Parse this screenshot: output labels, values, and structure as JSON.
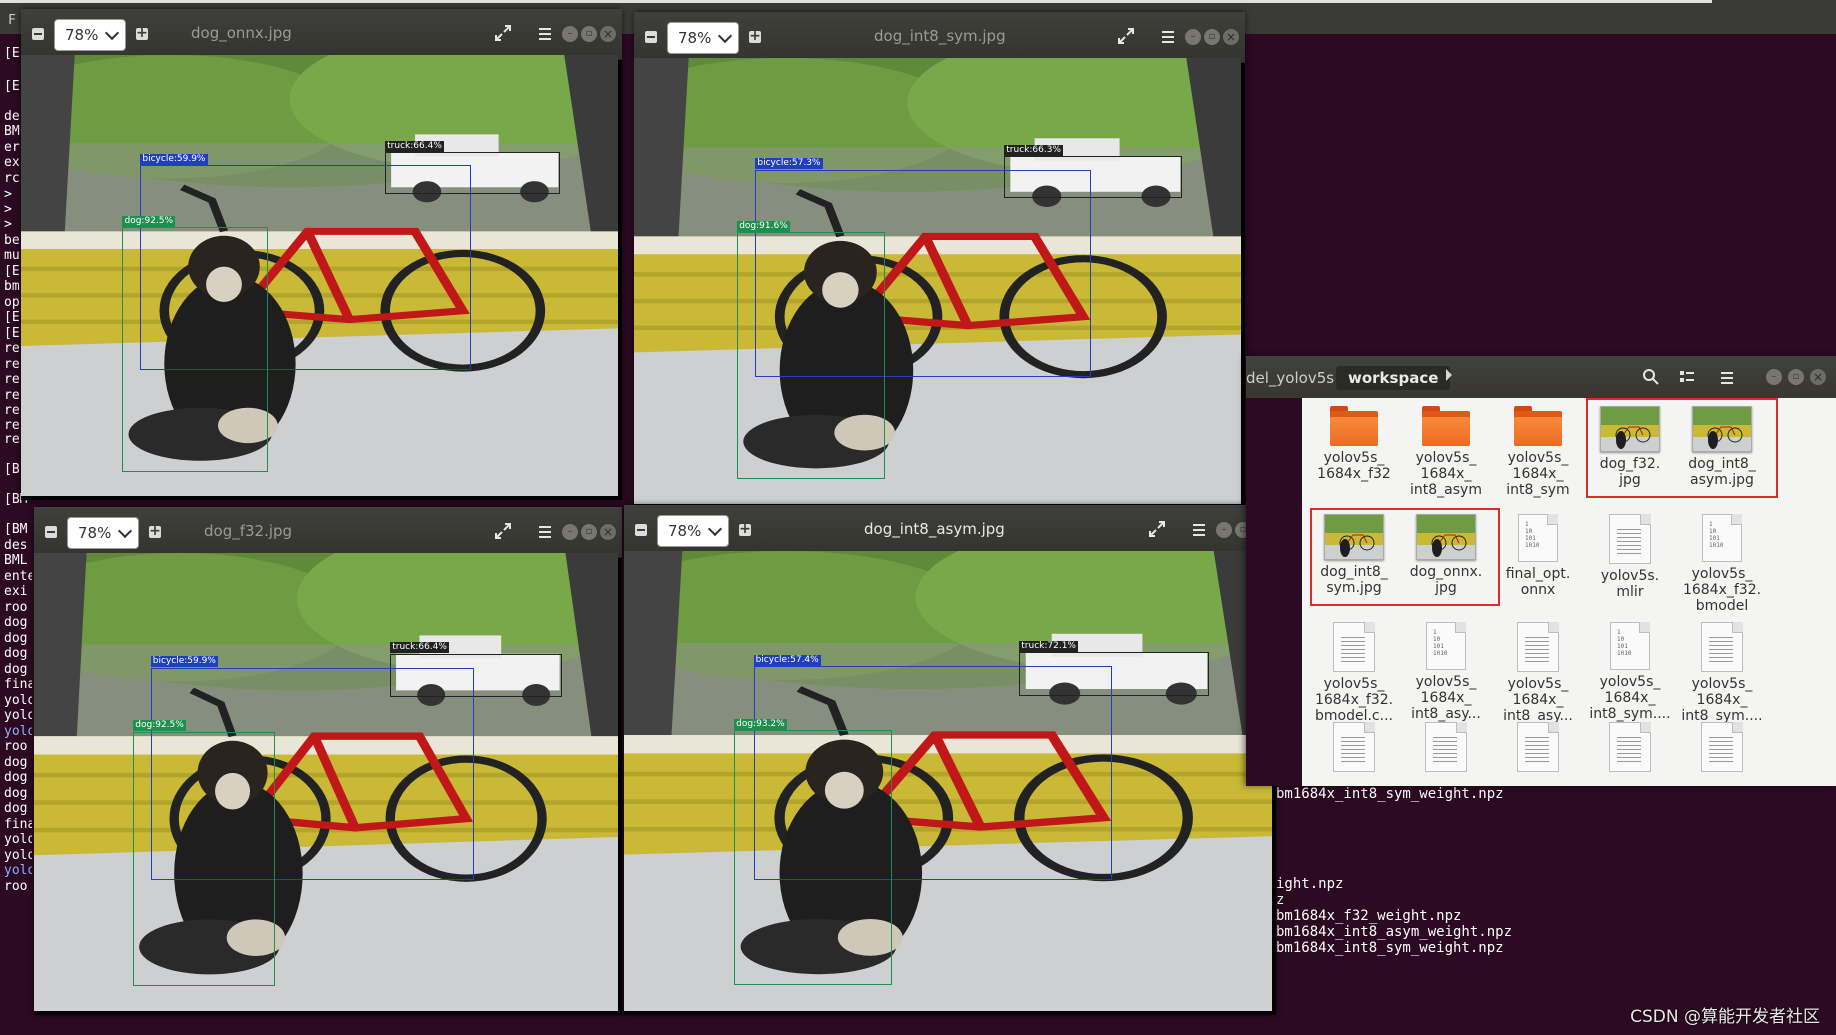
{
  "terminal": {
    "top_menu": "F",
    "left_fragments": [
      "[E",
      "[E",
      "de",
      "BM",
      "er",
      "ex",
      "rc",
      ">",
      ">",
      ">",
      "be",
      "mu",
      "[E",
      "bm",
      "op",
      "[E",
      "[E",
      "re",
      "re",
      "re",
      "re",
      "re",
      "re",
      "re",
      "[B",
      "[BM",
      "[BM",
      "des",
      "BML",
      "ente",
      "exi",
      "roo",
      "dog",
      "dog",
      "dog",
      "dog",
      "fina",
      "yolo",
      "yolo",
      "yolo",
      "roo",
      "dog",
      "dog",
      "dog",
      "dog",
      "fina",
      "yolo",
      "yolo",
      "yolo",
      "roo"
    ],
    "right_lines": [
      "bm1684x_int8_asym_weight.npz",
      "bm1684x_int8_sym_weight.npz",
      "ight.npz",
      "z",
      "bm1684x_f32_weight.npz",
      "bm1684x_int8_asym_weight.npz",
      "bm1684x_int8_sym_weight.npz"
    ]
  },
  "viewers": [
    {
      "name": "dog_onnx",
      "title": "dog_onnx.jpg",
      "zoom": "78%",
      "active": false,
      "detections": [
        {
          "label": "truck:66.4%",
          "color": "#222222"
        },
        {
          "label": "bicycle:59.9%",
          "color": "#1f3fbf"
        },
        {
          "label": "dog:92.5%",
          "color": "#1f8f4f"
        }
      ]
    },
    {
      "name": "dog_int8_sym",
      "title": "dog_int8_sym.jpg",
      "zoom": "78%",
      "active": false,
      "detections": [
        {
          "label": "truck:66.3%",
          "color": "#222222"
        },
        {
          "label": "bicycle:57.3%",
          "color": "#1f3fbf"
        },
        {
          "label": "dog:91.6%",
          "color": "#1f8f4f"
        }
      ]
    },
    {
      "name": "dog_f32",
      "title": "dog_f32.jpg",
      "zoom": "78%",
      "active": false,
      "detections": [
        {
          "label": "truck:66.4%",
          "color": "#222222"
        },
        {
          "label": "bicycle:59.9%",
          "color": "#1f3fbf"
        },
        {
          "label": "dog:92.5%",
          "color": "#1f8f4f"
        }
      ]
    },
    {
      "name": "dog_int8_asym",
      "title": "dog_int8_asym.jpg",
      "zoom": "78%",
      "active": true,
      "detections": [
        {
          "label": "truck:72.1%",
          "color": "#222222"
        },
        {
          "label": "bicycle:57.4%",
          "color": "#1f3fbf"
        },
        {
          "label": "dog:93.2%",
          "color": "#1f8f4f"
        }
      ]
    }
  ],
  "file_manager": {
    "breadcrumb_prev": "del_yolov5s",
    "breadcrumb_current": "workspace",
    "icons": [
      "search-icon",
      "view-list-icon",
      "menu-icon",
      "minimize-icon",
      "maximize-icon",
      "close-icon"
    ],
    "items": [
      {
        "label": "yolov5s_\n1684x_f32",
        "kind": "folder"
      },
      {
        "label": "yolov5s_\n1684x_\nint8_asym",
        "kind": "folder"
      },
      {
        "label": "yolov5s_\n1684x_\nint8_sym",
        "kind": "folder"
      },
      {
        "label": "dog_f32.\njpg",
        "kind": "image"
      },
      {
        "label": "dog_int8_\nasym.jpg",
        "kind": "image"
      },
      {
        "label": "dog_int8_\nsym.jpg",
        "kind": "image"
      },
      {
        "label": "dog_onnx.\njpg",
        "kind": "image"
      },
      {
        "label": "final_opt.\nonnx",
        "kind": "binary"
      },
      {
        "label": "yolov5s.\nmlir",
        "kind": "text"
      },
      {
        "label": "yolov5s_\n1684x_f32.\nbmodel",
        "kind": "binary"
      },
      {
        "label": "yolov5s_\n1684x_f32.\nbmodel.c...",
        "kind": "text"
      },
      {
        "label": "yolov5s_\n1684x_\nint8_asy...",
        "kind": "binary"
      },
      {
        "label": "yolov5s_\n1684x_\nint8_asy...",
        "kind": "text"
      },
      {
        "label": "yolov5s_\n1684x_\nint8_sym....",
        "kind": "binary"
      },
      {
        "label": "yolov5s_\n1684x_\nint8_sym....",
        "kind": "text"
      },
      {
        "label": "",
        "kind": "text"
      },
      {
        "label": "",
        "kind": "text"
      },
      {
        "label": "",
        "kind": "text"
      },
      {
        "label": "",
        "kind": "text"
      },
      {
        "label": "",
        "kind": "text"
      }
    ],
    "binary_glyph": "1\n10\n101\n1010"
  },
  "watermark": "CSDN @算能开发者社区",
  "colors": {
    "highlight": "#e12b2b",
    "close_active": "#e25e3a"
  }
}
